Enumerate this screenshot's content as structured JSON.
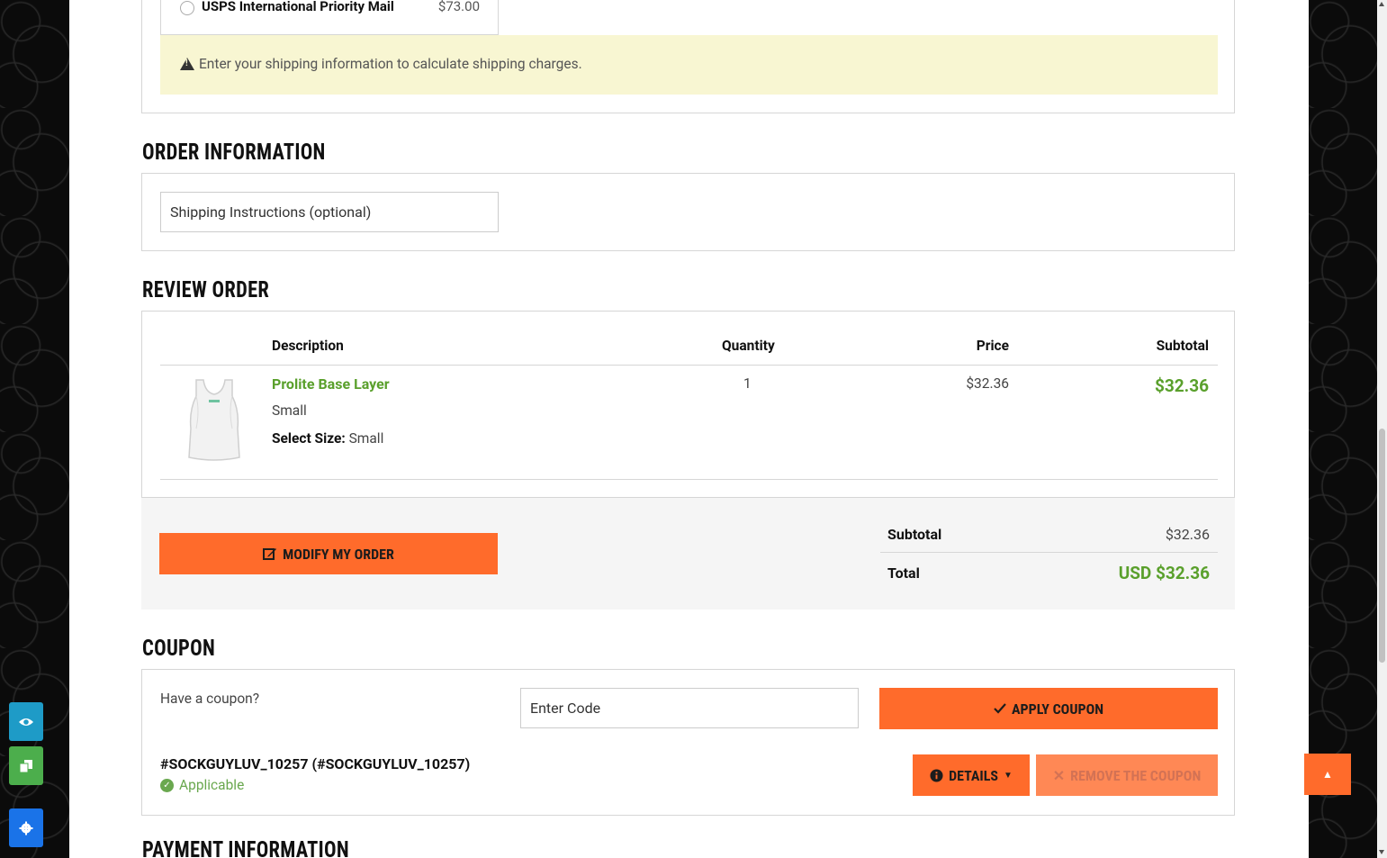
{
  "shipping": {
    "option_name": "USPS International Priority Mail",
    "option_price": "$73.00",
    "alert_text": "Enter your shipping information to calculate shipping charges."
  },
  "order_information": {
    "heading": "ORDER INFORMATION",
    "instructions_placeholder": "Shipping Instructions (optional)"
  },
  "review_order": {
    "heading": "REVIEW ORDER",
    "columns": [
      "Description",
      "Quantity",
      "Price",
      "Subtotal"
    ],
    "items": [
      {
        "name": "Prolite Base Layer",
        "variant": "Small",
        "option_label": "Select Size:",
        "option_value": "Small",
        "quantity": "1",
        "price": "$32.36",
        "subtotal": "$32.36"
      }
    ],
    "modify_button": "MODIFY MY ORDER",
    "totals": {
      "subtotal_label": "Subtotal",
      "subtotal_value": "$32.36",
      "total_label": "Total",
      "total_value": "USD $32.36"
    }
  },
  "coupon": {
    "heading": "COUPON",
    "question": "Have a coupon?",
    "code_placeholder": "Enter Code",
    "apply_button": "APPLY COUPON",
    "applied_code": "#SOCKGUYLUV_10257 (#SOCKGUYLUV_10257)",
    "status": "Applicable",
    "details_button": "DETAILS",
    "remove_button": "REMOVE THE COUPON"
  },
  "payment": {
    "heading": "PAYMENT INFORMATION"
  },
  "colors": {
    "accent": "#ff6b2b",
    "price_green": "#5aa02c",
    "alert_bg": "#f8f6d2"
  },
  "icons": {
    "float_1": "eye-icon",
    "float_2": "copy-icon",
    "float_3": "gear-icon",
    "to_top": "caret-up-icon"
  }
}
